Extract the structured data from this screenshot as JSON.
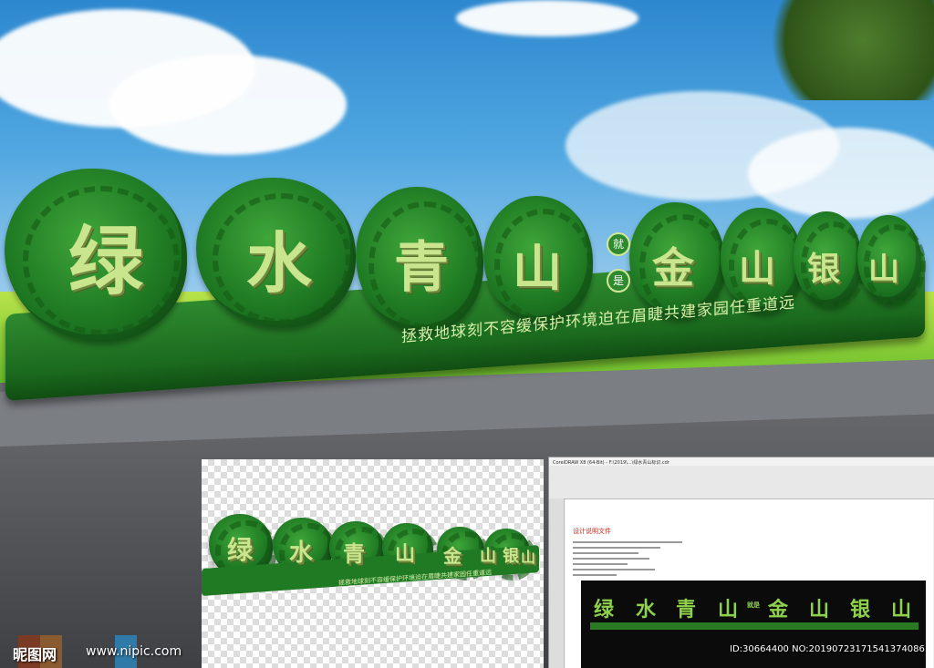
{
  "colors": {
    "sky": "#4fa6e0",
    "sign_green": "#1f7a23",
    "character_face": "#c9e58d",
    "slogan_text": "#d7f0a8",
    "road": "#4a4d52"
  },
  "main_sign": {
    "characters_left": [
      "绿",
      "水",
      "青",
      "山"
    ],
    "connector_top": "就",
    "connector_bottom": "是",
    "characters_right": [
      "金",
      "山",
      "银",
      "山"
    ],
    "slogan": "拯救地球刻不容缓保护环境迫在眉睫共建家园任重道远"
  },
  "preview_panel": {
    "characters": [
      "绿",
      "水",
      "青",
      "山",
      "金",
      "山",
      "银",
      "山"
    ],
    "slogan": "拯救地球刻不容缓保护环境迫在眉睫共建家园任重道远"
  },
  "coreldraw_panel": {
    "window_title": "CorelDRAW X8 (64-Bit) - F:\\2019\\...\\绿水青山标识.cdr",
    "design_title": "设计说明文件",
    "dark_characters": [
      "绿",
      "水",
      "青",
      "山",
      "金",
      "山",
      "银",
      "山"
    ],
    "connector": "就是"
  },
  "watermark": {
    "logo_text": "昵图网",
    "url": "www.nipic.com",
    "id_text": "ID:30664400 NO:20190723171541374086"
  }
}
